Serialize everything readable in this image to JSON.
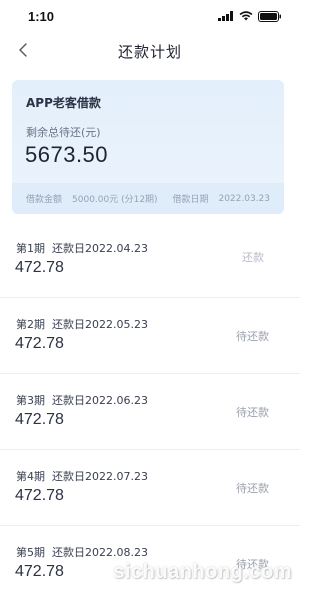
{
  "status_bar": {
    "time": "1:10"
  },
  "nav": {
    "title": "还款计划",
    "back_icon": "chevron-left-icon"
  },
  "summary": {
    "product_name": "APP老客借款",
    "remaining_label": "剩余总待还(元)",
    "remaining_amount": "5673.50",
    "loan_amount_label": "借款金额",
    "loan_amount_value": "5000.00元 (分12期)",
    "loan_date_label": "借款日期",
    "loan_date_value": "2022.03.23"
  },
  "installments": [
    {
      "period": "第1期",
      "due_date": "还款日2022.04.23",
      "amount": "472.78",
      "status": "还款"
    },
    {
      "period": "第2期",
      "due_date": "还款日2022.05.23",
      "amount": "472.78",
      "status": "待还款"
    },
    {
      "period": "第3期",
      "due_date": "还款日2022.06.23",
      "amount": "472.78",
      "status": "待还款"
    },
    {
      "period": "第4期",
      "due_date": "还款日2022.07.23",
      "amount": "472.78",
      "status": "待还款"
    },
    {
      "period": "第5期",
      "due_date": "还款日2022.08.23",
      "amount": "472.78",
      "status": "待还款"
    }
  ],
  "watermark": "sichuanhong.com",
  "colors": {
    "card_background": "#e6f0fb",
    "accent_text": "#1e2434",
    "muted_text": "#9aa0ad"
  }
}
